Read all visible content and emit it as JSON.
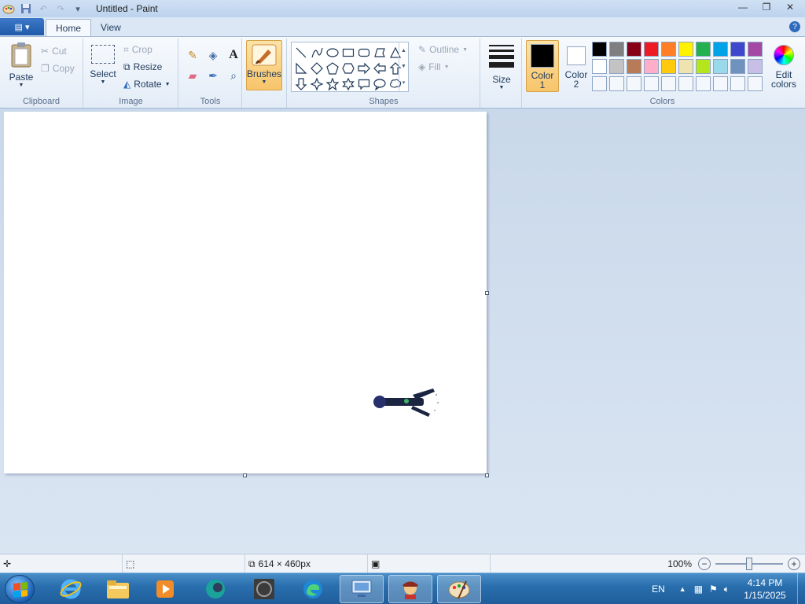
{
  "window": {
    "title": "Untitled - Paint",
    "controls": [
      "minimize-icon",
      "restore-icon",
      "close-icon"
    ]
  },
  "ribbon": {
    "tabs": [
      {
        "label": "Home",
        "active": true
      },
      {
        "label": "View",
        "active": false
      }
    ],
    "clipboard": {
      "group_label": "Clipboard",
      "paste": "Paste",
      "cut": "Cut",
      "copy": "Copy"
    },
    "image": {
      "group_label": "Image",
      "select": "Select",
      "crop": "Crop",
      "resize": "Resize",
      "rotate": "Rotate"
    },
    "tools": {
      "group_label": "Tools"
    },
    "brushes": {
      "label": "Brushes"
    },
    "shapes": {
      "group_label": "Shapes",
      "outline": "Outline",
      "fill": "Fill"
    },
    "size": {
      "label": "Size"
    },
    "colors": {
      "group_label": "Colors",
      "color1_label": "Color\n1",
      "color1_line1": "Color",
      "color1_line2": "1",
      "color2_line1": "Color",
      "color2_line2": "2",
      "edit_line1": "Edit",
      "edit_line2": "colors",
      "color1_value": "#000000",
      "color2_value": "#ffffff",
      "palette_row1": [
        "#000000",
        "#7f7f7f",
        "#880015",
        "#ed1c24",
        "#ff7f27",
        "#fff200",
        "#22b14c",
        "#00a2e8",
        "#3f48cc",
        "#a349a4"
      ],
      "palette_row2": [
        "#ffffff",
        "#c3c3c3",
        "#b97a57",
        "#ffaec9",
        "#ffc90e",
        "#efe4b0",
        "#b5e61d",
        "#99d9ea",
        "#7092be",
        "#c8bfe7"
      ]
    }
  },
  "status": {
    "canvas_size": "614 × 460px",
    "zoom": "100%",
    "zoom_fraction": 0.5
  },
  "taskbar": {
    "language": "EN",
    "time": "4:14 PM",
    "date": "1/15/2025"
  }
}
